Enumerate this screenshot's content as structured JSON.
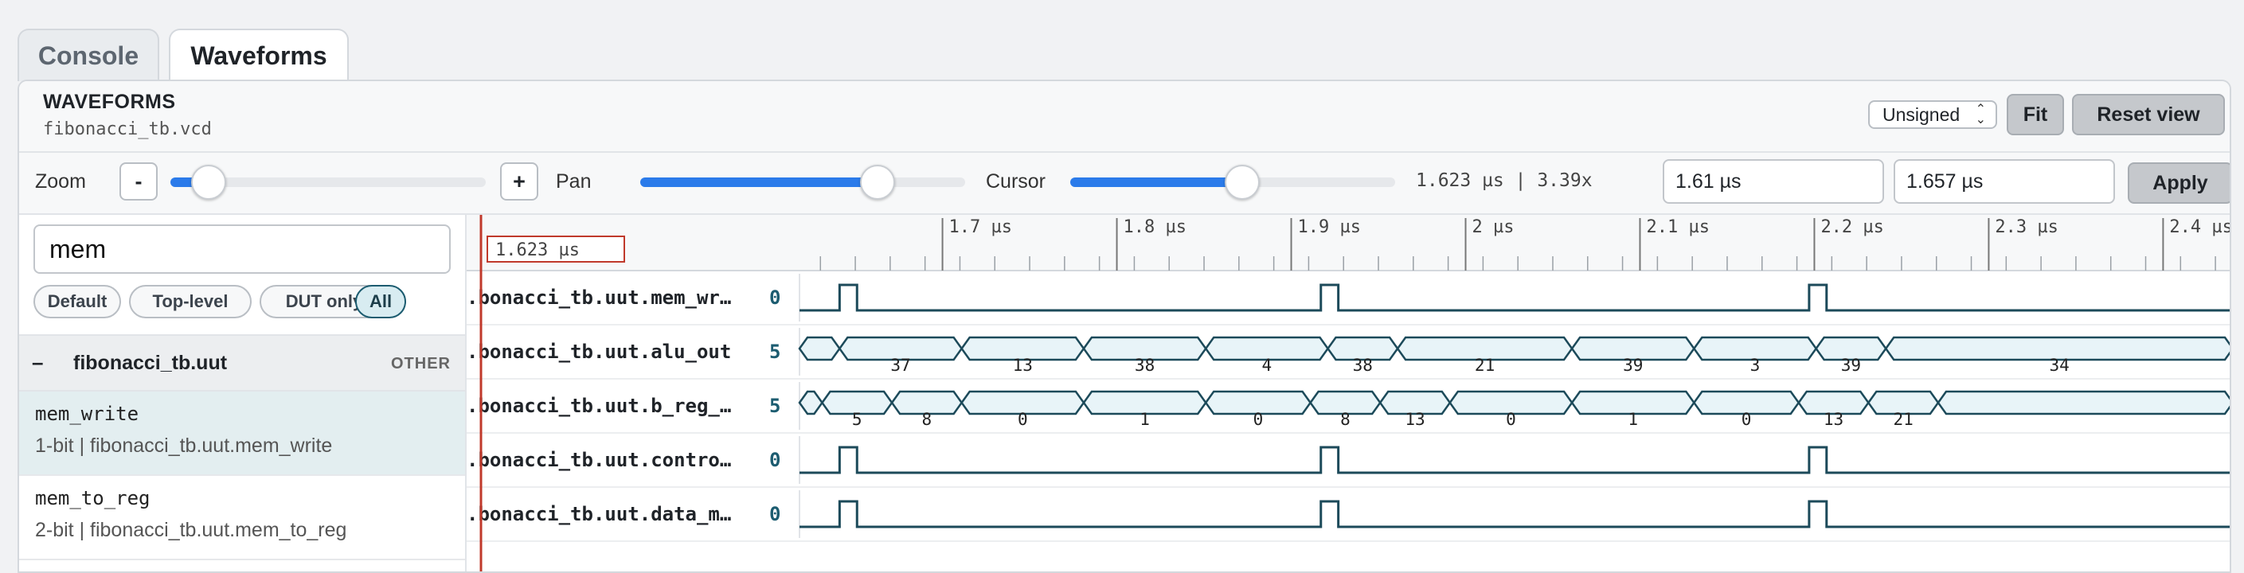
{
  "tabs": [
    {
      "label": "Console",
      "active": false
    },
    {
      "label": "Waveforms",
      "active": true
    }
  ],
  "header": {
    "title": "WAVEFORMS",
    "file": "fibonacci_tb.vcd",
    "radix": "Unsigned",
    "fit_label": "Fit",
    "reset_label": "Reset view"
  },
  "controls": {
    "zoom_label": "Zoom",
    "zoom_out": "-",
    "zoom_in": "+",
    "zoom_level": 0.12,
    "pan_label": "Pan",
    "pan_level": 0.73,
    "cursor_label": "Cursor",
    "cursor_level": 0.53,
    "readout": "1.623 µs | 3.39x",
    "range_start": "1.61 µs",
    "range_end": "1.657 µs",
    "apply_label": "Apply"
  },
  "sidebar": {
    "search_value": "mem",
    "filters": [
      {
        "label": "Default",
        "active": false
      },
      {
        "label": "Top-level",
        "active": false
      },
      {
        "label": "DUT only",
        "active": false
      },
      {
        "label": "All",
        "active": true
      }
    ],
    "group": {
      "toggle": "–",
      "name": "fibonacci_tb.uut",
      "tag": "OTHER"
    },
    "items": [
      {
        "name": "mem_write",
        "desc": "1-bit | fibonacci_tb.uut.mem_write",
        "selected": true
      },
      {
        "name": "mem_to_reg",
        "desc": "2-bit | fibonacci_tb.uut.mem_to_reg",
        "selected": false
      }
    ]
  },
  "timeline": {
    "cursor_label": "1.623 µs",
    "cursor_time": 1.623,
    "ticks": [
      {
        "t": 1.7,
        "label": "1.7 µs"
      },
      {
        "t": 1.8,
        "label": "1.8 µs"
      },
      {
        "t": 1.9,
        "label": "1.9 µs"
      },
      {
        "t": 2.0,
        "label": "2 µs"
      },
      {
        "t": 2.1,
        "label": "2.1 µs"
      },
      {
        "t": 2.2,
        "label": "2.2 µs"
      },
      {
        "t": 2.3,
        "label": "2.3 µs"
      },
      {
        "t": 2.4,
        "label": "2.4 µs"
      }
    ],
    "view_start": 1.618,
    "view_end": 2.44
  },
  "signals": [
    {
      "label": ".bonacci_tb.uut.mem_wr…",
      "value": "0",
      "kind": "bit",
      "pulses": [
        [
          1.641,
          1.651
        ],
        [
          1.917,
          1.927
        ],
        [
          2.197,
          2.207
        ]
      ]
    },
    {
      "label": ".bonacci_tb.uut.alu_out",
      "value": "5",
      "kind": "bus",
      "segments": [
        {
          "start": 1.618,
          "end": 1.641,
          "label": ""
        },
        {
          "start": 1.641,
          "end": 1.711,
          "label": "37"
        },
        {
          "start": 1.711,
          "end": 1.781,
          "label": "13"
        },
        {
          "start": 1.781,
          "end": 1.851,
          "label": "38"
        },
        {
          "start": 1.851,
          "end": 1.921,
          "label": "4"
        },
        {
          "start": 1.921,
          "end": 1.961,
          "label": "38"
        },
        {
          "start": 1.961,
          "end": 2.061,
          "label": "21"
        },
        {
          "start": 2.061,
          "end": 2.131,
          "label": "39"
        },
        {
          "start": 2.131,
          "end": 2.201,
          "label": "3"
        },
        {
          "start": 2.201,
          "end": 2.241,
          "label": "39"
        },
        {
          "start": 2.241,
          "end": 2.44,
          "label": "34"
        }
      ]
    },
    {
      "label": ".bonacci_tb.uut.b_reg_…",
      "value": "5",
      "kind": "bus",
      "segments": [
        {
          "start": 1.618,
          "end": 1.631,
          "label": ""
        },
        {
          "start": 1.631,
          "end": 1.671,
          "label": "5"
        },
        {
          "start": 1.671,
          "end": 1.711,
          "label": "8"
        },
        {
          "start": 1.711,
          "end": 1.781,
          "label": "0"
        },
        {
          "start": 1.781,
          "end": 1.851,
          "label": "1"
        },
        {
          "start": 1.851,
          "end": 1.911,
          "label": "0"
        },
        {
          "start": 1.911,
          "end": 1.951,
          "label": "8"
        },
        {
          "start": 1.951,
          "end": 1.991,
          "label": "13"
        },
        {
          "start": 1.991,
          "end": 2.061,
          "label": "0"
        },
        {
          "start": 2.061,
          "end": 2.131,
          "label": "1"
        },
        {
          "start": 2.131,
          "end": 2.191,
          "label": "0"
        },
        {
          "start": 2.191,
          "end": 2.231,
          "label": "13"
        },
        {
          "start": 2.231,
          "end": 2.271,
          "label": "21"
        },
        {
          "start": 2.271,
          "end": 2.44,
          "label": ""
        }
      ]
    },
    {
      "label": ".bonacci_tb.uut.contro…",
      "value": "0",
      "kind": "bit",
      "pulses": [
        [
          1.641,
          1.651
        ],
        [
          1.917,
          1.927
        ],
        [
          2.197,
          2.207
        ]
      ]
    },
    {
      "label": ".bonacci_tb.uut.data_m…",
      "value": "0",
      "kind": "bit",
      "pulses": [
        [
          1.641,
          1.651
        ],
        [
          1.917,
          1.927
        ],
        [
          2.197,
          2.207
        ]
      ]
    }
  ],
  "colors": {
    "accent": "#2b7bea",
    "trace": "#1c4a5a",
    "bus_fill": "#e8f4f8",
    "cursor": "#c0392b"
  }
}
